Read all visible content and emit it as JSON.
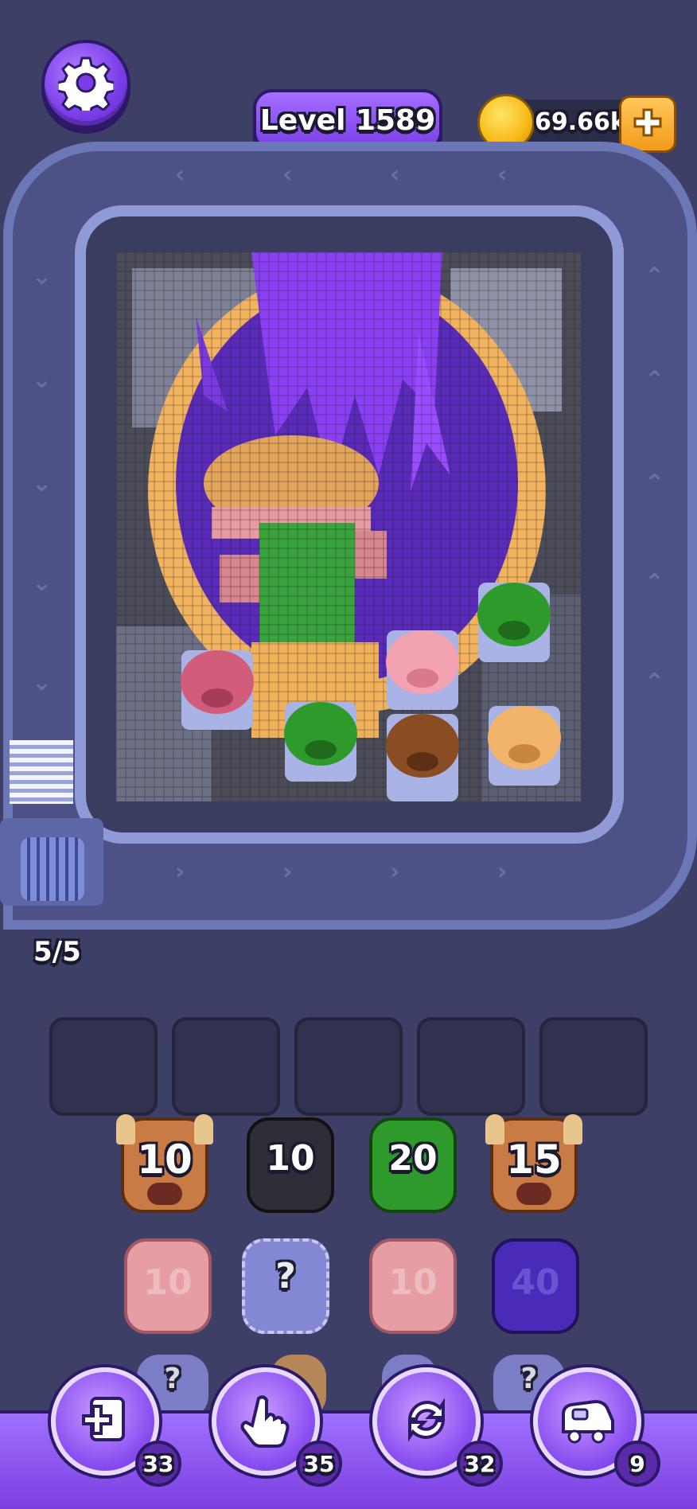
{
  "header": {
    "level_label": "Level 1589",
    "coins": "69.66k"
  },
  "conveyor": {
    "capacity": "5/5"
  },
  "slots": {
    "count": 5
  },
  "shooters": {
    "row1": [
      {
        "type": "bull",
        "count": "10",
        "color": "#c97b45"
      },
      {
        "type": "block",
        "count": "10",
        "color": "#2e2e38"
      },
      {
        "type": "block",
        "count": "20",
        "color": "#2f9a2c"
      },
      {
        "type": "bull",
        "count": "15",
        "color": "#c97b45"
      }
    ],
    "row2": [
      {
        "type": "block",
        "count": "10",
        "color": "#f0a3a8"
      },
      {
        "type": "mystery",
        "count": "?",
        "color": "#8c8fe0"
      },
      {
        "type": "block",
        "count": "10",
        "color": "#f0a3a8"
      },
      {
        "type": "block",
        "count": "40",
        "color": "#4a2ab8"
      }
    ],
    "row3": [
      {
        "type": "mystery",
        "count": "?",
        "color": "#8c8fe0"
      },
      {
        "type": "mystery",
        "count": "",
        "color": "#d39a55"
      },
      {
        "type": "mystery",
        "count": "",
        "color": "#8c8fe0"
      },
      {
        "type": "mystery",
        "count": "?",
        "color": "#8c8fe0"
      }
    ]
  },
  "boosters": [
    {
      "name": "add-slot",
      "count": "33",
      "icon": "add-card-icon"
    },
    {
      "name": "hand",
      "count": "35",
      "icon": "pointer-hand-icon"
    },
    {
      "name": "shuffle",
      "count": "32",
      "icon": "refresh-icon"
    },
    {
      "name": "train",
      "count": "9",
      "icon": "train-icon"
    }
  ],
  "colors": {
    "background": "#3d3f66",
    "accent": "#8a4ff0",
    "coin": "#f7b916"
  }
}
